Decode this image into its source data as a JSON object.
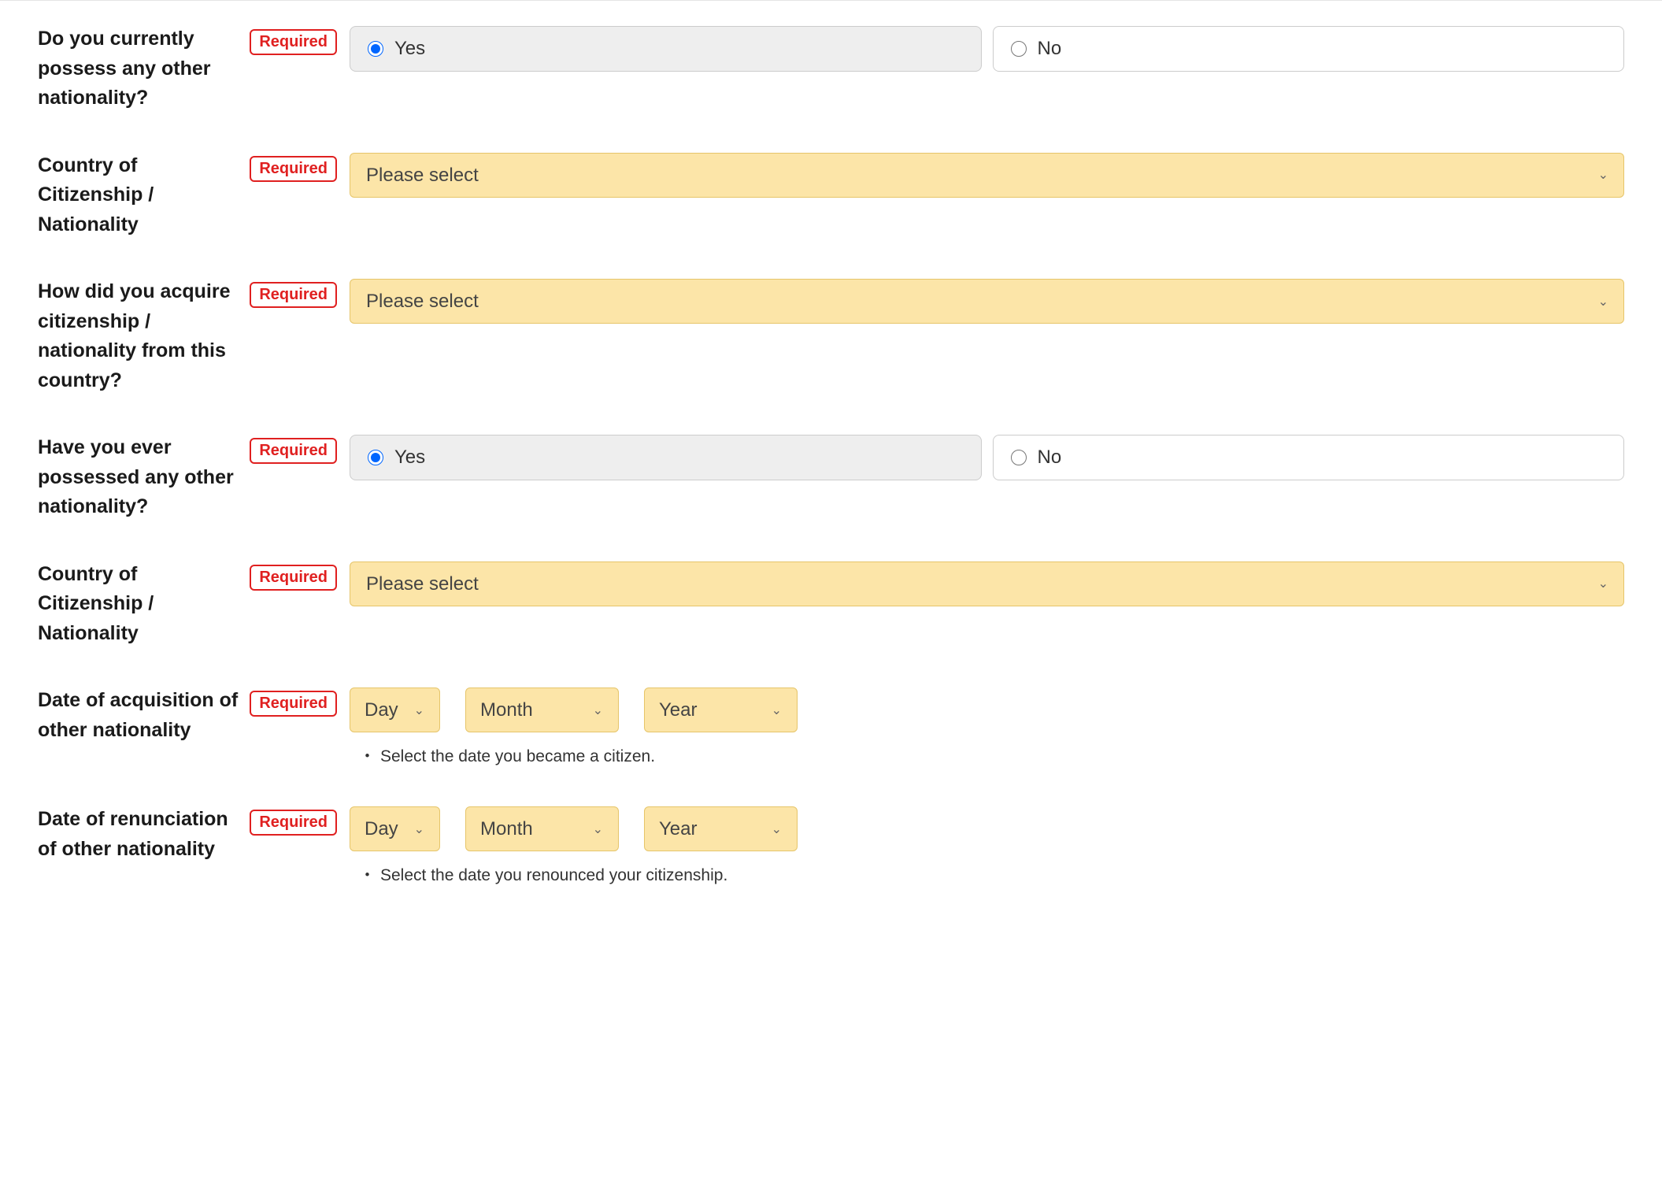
{
  "badges": {
    "required": "Required"
  },
  "options": {
    "yes": "Yes",
    "no": "No",
    "please_select": "Please select",
    "day": "Day",
    "month": "Month",
    "year": "Year"
  },
  "rows": {
    "q1": {
      "label": "Do you currently possess any other nationality?"
    },
    "q2": {
      "label": "Country of Citizenship / Nationality"
    },
    "q3": {
      "label": "How did you acquire citizenship / nationality from this country?"
    },
    "q4": {
      "label": "Have you ever possessed any other nationality?"
    },
    "q5": {
      "label": "Country of Citizenship / Nationality"
    },
    "q6": {
      "label": "Date of acquisition of other nationality",
      "hint": "Select the date you became a citizen."
    },
    "q7": {
      "label": "Date of renunciation of other nationality",
      "hint": "Select the date you renounced your citizenship."
    }
  }
}
